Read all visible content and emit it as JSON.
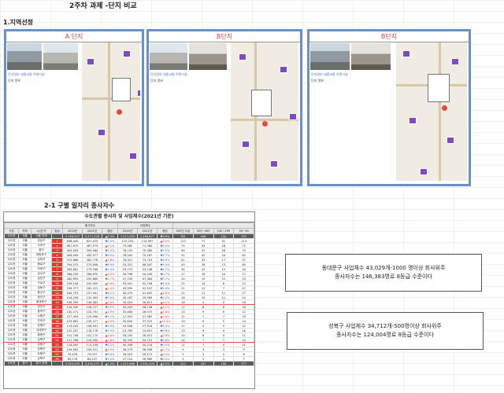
{
  "title": "2주차 과제 -단지 비교",
  "section1": "1.지역선정",
  "panels": [
    {
      "header": "A 단지"
    },
    {
      "header": "B단지"
    },
    {
      "header": "B단지"
    }
  ],
  "panel_tabs": "단지정보  대중교통  주변시설",
  "panel_info_label": "단지 정보",
  "section2": "2-1 구별 일자리 종사자수",
  "table": {
    "title": "수도권별 종사자 및 사업체수(2021년 기준)",
    "headers": [
      "구분",
      "지역",
      "시/군/구",
      "등급",
      "2020년",
      "2021년",
      "증감",
      "2020년",
      "2021년",
      "증감",
      "500인 이상",
      "300~499",
      "100~299",
      "50~99"
    ],
    "group_labels": {
      "workers": "종사자수",
      "companies": "사업체수"
    },
    "rows": [
      [
        "수도권",
        "서울",
        "서울 전체",
        "",
        "5,156,007",
        "5,171,226",
        "▲0.3%",
        "1,211,003",
        "1,166,877",
        "▼3.6%",
        "761",
        "448",
        "154",
        "751"
      ],
      [
        "수도권",
        "서울",
        "강남구",
        "1",
        "838,444",
        "821,419",
        "▼2.0%",
        "115,204",
        "115,397",
        "▲0.2%",
        "112",
        "71",
        "41",
        "113"
      ],
      [
        "수도권",
        "서울",
        "서초구",
        "2",
        "487,670",
        "487,975",
        "▲0.1%",
        "75,460",
        "71,380",
        "▼5.4%",
        "74",
        "43",
        "18",
        "75"
      ],
      [
        "수도권",
        "서울",
        "중구",
        "3",
        "409,094",
        "399,568",
        "▼2.3%",
        "76,129",
        "70,389",
        "▼7.5%",
        "56",
        "47",
        "26",
        "79"
      ],
      [
        "수도권",
        "서울",
        "영등포구",
        "4",
        "406,099",
        "405,977",
        "▼0.0%",
        "78,043",
        "75,187",
        "▼3.7%",
        "51",
        "42",
        "24",
        "82"
      ],
      [
        "수도권",
        "서울",
        "송파구",
        "5",
        "375,886",
        "382,778",
        "▲1.8%",
        "76,412",
        "73,703",
        "▼3.5%",
        "42",
        "32",
        "17",
        "57"
      ],
      [
        "수도권",
        "서울",
        "종로구",
        "6",
        "294,575",
        "275,658",
        "▼6.4%",
        "53,321",
        "48,347",
        "▼9.3%",
        "40",
        "28",
        "13",
        "60"
      ],
      [
        "수도권",
        "서울",
        "마포구",
        "7",
        "283,661",
        "279,768",
        "▼1.4%",
        "55,775",
        "53,138",
        "▼4.7%",
        "34",
        "22",
        "12",
        "34"
      ],
      [
        "수도권",
        "서울",
        "강서구",
        "8",
        "266,239",
        "266,675",
        "▲0.2%",
        "50,796",
        "50,439",
        "▼0.7%",
        "27",
        "19",
        "10",
        "27"
      ],
      [
        "수도권",
        "서울",
        "금천구",
        "9",
        "262,693",
        "255,689",
        "▼2.7%",
        "47,704",
        "47,364",
        "▼0.7%",
        "24",
        "15",
        "12",
        "23"
      ],
      [
        "수도권",
        "서울",
        "구로구",
        "10",
        "239,196",
        "240,099",
        "▲0.4%",
        "53,541",
        "52,746",
        "▼1.5%",
        "22",
        "14",
        "8",
        "22"
      ],
      [
        "수도권",
        "서울",
        "성동구",
        "11",
        "196,377",
        "200,221",
        "▲2.0%",
        "43,599",
        "42,547",
        "▼2.4%",
        "21",
        "12",
        "7",
        "27"
      ],
      [
        "수도권",
        "서울",
        "용산구",
        "12",
        "164,793",
        "157,901",
        "▼4.2%",
        "40,379",
        "41,602",
        "▲3.0%",
        "21",
        "11",
        "11",
        "27"
      ],
      [
        "수도권",
        "서울",
        "광진구",
        "13",
        "154,298",
        "152,900",
        "▼0.9%",
        "30,287",
        "29,589",
        "▼2.3%",
        "18",
        "10",
        "11",
        "24"
      ],
      [
        "수도권",
        "서울",
        "동대문구",
        "14",
        "146,359",
        "146,383",
        "▲0.0%",
        "35,029",
        "36,813",
        "▲5.1%",
        "18",
        "9",
        "9",
        "18"
      ],
      [
        "수도권",
        "서울",
        "양천구",
        "15",
        "134,349",
        "128,727",
        "▼4.2%",
        "35,403",
        "36,138",
        "▲2.1%",
        "17",
        "8",
        "6",
        "16"
      ],
      [
        "수도권",
        "서울",
        "동작구",
        "16",
        "130,271",
        "132,751",
        "▲1.9%",
        "25,608",
        "26,070",
        "▲1.8%",
        "13",
        "9",
        "6",
        "12"
      ],
      [
        "수도권",
        "서울",
        "노원구",
        "17",
        "127,454",
        "125,998",
        "▼1.1%",
        "27,452",
        "27,565",
        "▲0.4%",
        "12",
        "7",
        "7",
        "16"
      ],
      [
        "수도권",
        "서울",
        "관악구",
        "18",
        "123,681",
        "128,477",
        "▲3.9%",
        "33,620",
        "37,315",
        "▲11.0%",
        "10",
        "6",
        "5",
        "14"
      ],
      [
        "수도권",
        "서울",
        "은평구",
        "19",
        "113,042",
        "108,591",
        "▼3.9%",
        "29,506",
        "27,918",
        "▼5.4%",
        "11",
        "5",
        "5",
        "12"
      ],
      [
        "수도권",
        "서울",
        "서대문구",
        "20",
        "122,347",
        "118,278",
        "▼3.3%",
        "23,789",
        "23,601",
        "▼0.8%",
        "13",
        "9",
        "4",
        "16"
      ],
      [
        "수도권",
        "서울",
        "중랑구",
        "21",
        "101,748",
        "102,179",
        "▲0.4%",
        "28,200",
        "28,451",
        "▲0.9%",
        "10",
        "6",
        "4",
        "11"
      ],
      [
        "수도권",
        "서울",
        "성북구",
        "22",
        "121,766",
        "124,004",
        "▲1.8%",
        "34,935",
        "34,712",
        "▼0.6%",
        "14",
        "7",
        "7",
        "14"
      ],
      [
        "수도권",
        "서울",
        "강동구",
        "23",
        "118,495",
        "113,156",
        "▼4.5%",
        "30,358",
        "30,218",
        "▼0.5%",
        "11",
        "7",
        "4",
        "11"
      ],
      [
        "수도권",
        "서울",
        "강북구",
        "24",
        "106,962",
        "109,011",
        "▲1.9%",
        "36,273",
        "36,536",
        "▲0.7%",
        "9",
        "3",
        "3",
        "9"
      ],
      [
        "수도권",
        "서울",
        "도봉구",
        "25",
        "79,428",
        "79,097",
        "▼0.4%",
        "26,025",
        "26,112",
        "▲0.3%",
        "5",
        "3",
        "2",
        "8"
      ],
      [
        "수도권",
        "서울",
        "강북구",
        "26",
        "85,276",
        "84,222",
        "▼1.2%",
        "27,124",
        "26,985",
        "▼0.5%",
        "3",
        "2",
        "3",
        "7"
      ],
      [
        "수도권",
        "경기",
        "경기 전체",
        "",
        "5,354,050",
        "5,420,275",
        "▲1.2%",
        "1,415,666",
        "1,461,026",
        "▲3.2%",
        "313",
        "247",
        "193",
        "277"
      ]
    ]
  },
  "notes": [
    {
      "line1": "동대문구  사업체수 43,029개-1000 명이상 회사위주",
      "line2": "종사자수는 146,383명로 8등급 수준이다"
    },
    {
      "line1": "성북구  사업체수 34,712개-500명이상 회사위주",
      "line2": "종사자수는 124,004명로 8등급 수준이다"
    }
  ]
}
